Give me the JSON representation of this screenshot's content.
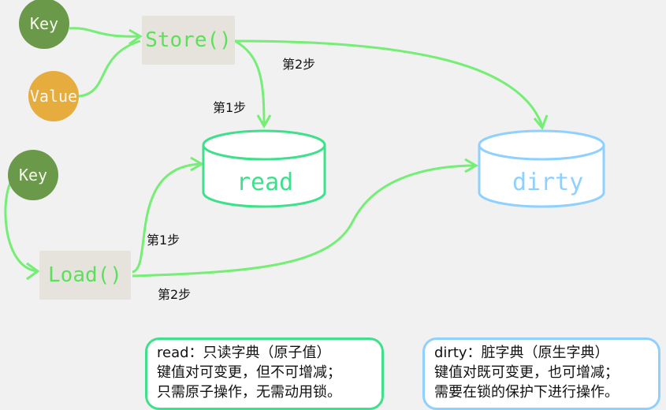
{
  "nodes": {
    "key_top": "Key",
    "value": "Value",
    "store": "Store()",
    "key_bottom": "Key",
    "load": "Load()",
    "read": "read",
    "dirty": "dirty"
  },
  "steps": {
    "store_step1": "第1步",
    "store_step2": "第2步",
    "load_step1": "第1步",
    "load_step2": "第2步"
  },
  "notes": {
    "read": {
      "line1": "read：只读字典（原子值）",
      "line2": "键值对可变更，但不可增减；",
      "line3": "只需原子操作，无需动用锁。"
    },
    "dirty": {
      "line1": "dirty：脏字典（原生字典）",
      "line2": "键值对既可变更，也可增减；",
      "line3": "需要在锁的保护下进行操作。"
    }
  },
  "colors": {
    "arrow": "#74ee74",
    "read_border": "#3fe08b",
    "dirty_border": "#8fd0ff",
    "key_node": "#6a9a49",
    "value_node": "#e6ac3d"
  }
}
